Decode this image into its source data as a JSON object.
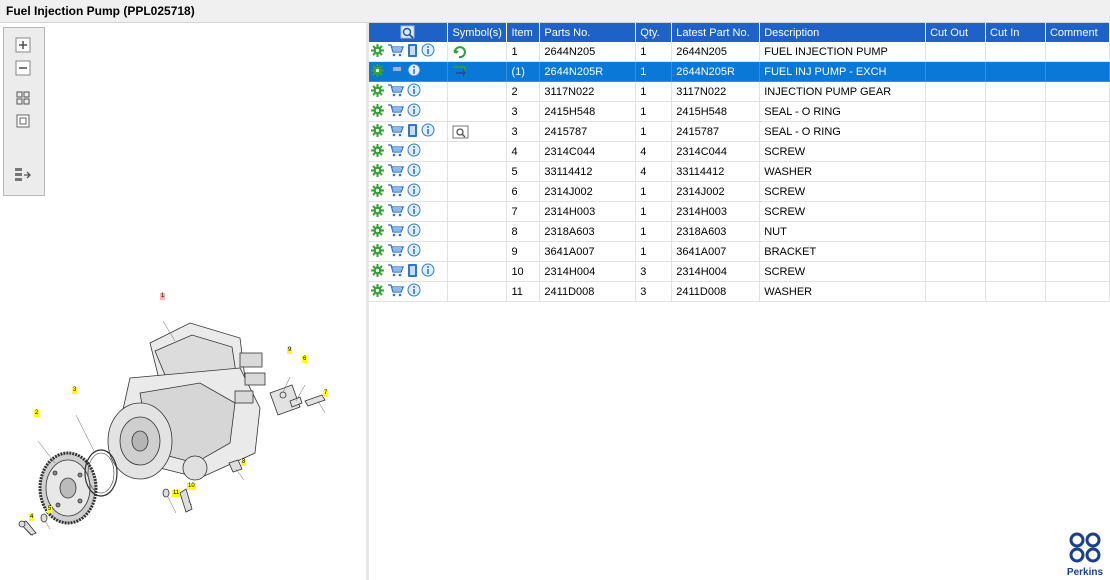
{
  "window": {
    "title": "Fuel Injection Pump (PPL025718)"
  },
  "table": {
    "headers": {
      "search": "",
      "symbols": "Symbol(s)",
      "item": "Item",
      "part_no": "Parts No.",
      "qty": "Qty.",
      "latest": "Latest Part No.",
      "description": "Description",
      "cut_out": "Cut Out",
      "cut_in": "Cut In",
      "comment": "Comment"
    },
    "rows": [
      {
        "item": "1",
        "part": "2644N205",
        "qty": "1",
        "latest": "2644N205",
        "desc": "FUEL INJECTION PUMP",
        "doc": true,
        "sym": "refresh"
      },
      {
        "item": "(1)",
        "part": "2644N205R",
        "qty": "1",
        "latest": "2644N205R",
        "desc": "FUEL INJ PUMP - EXCH",
        "doc": false,
        "sym": "exchange",
        "selected": true
      },
      {
        "item": "2",
        "part": "3117N022",
        "qty": "1",
        "latest": "3117N022",
        "desc": "INJECTION PUMP GEAR",
        "doc": false,
        "sym": ""
      },
      {
        "item": "3",
        "part": "2415H548",
        "qty": "1",
        "latest": "2415H548",
        "desc": "SEAL - O RING",
        "doc": false,
        "sym": ""
      },
      {
        "item": "3",
        "part": "2415787",
        "qty": "1",
        "latest": "2415787",
        "desc": "SEAL - O RING",
        "doc": true,
        "sym": "view"
      },
      {
        "item": "4",
        "part": "2314C044",
        "qty": "4",
        "latest": "2314C044",
        "desc": "SCREW",
        "doc": false,
        "sym": ""
      },
      {
        "item": "5",
        "part": "33114412",
        "qty": "4",
        "latest": "33114412",
        "desc": "WASHER",
        "doc": false,
        "sym": ""
      },
      {
        "item": "6",
        "part": "2314J002",
        "qty": "1",
        "latest": "2314J002",
        "desc": "SCREW",
        "doc": false,
        "sym": ""
      },
      {
        "item": "7",
        "part": "2314H003",
        "qty": "1",
        "latest": "2314H003",
        "desc": "SCREW",
        "doc": false,
        "sym": ""
      },
      {
        "item": "8",
        "part": "2318A603",
        "qty": "1",
        "latest": "2318A603",
        "desc": "NUT",
        "doc": false,
        "sym": ""
      },
      {
        "item": "9",
        "part": "3641A007",
        "qty": "1",
        "latest": "3641A007",
        "desc": "BRACKET",
        "doc": false,
        "sym": ""
      },
      {
        "item": "10",
        "part": "2314H004",
        "qty": "3",
        "latest": "2314H004",
        "desc": "SCREW",
        "doc": true,
        "sym": ""
      },
      {
        "item": "11",
        "part": "2411D008",
        "qty": "3",
        "latest": "2411D008",
        "desc": "WASHER",
        "doc": false,
        "sym": ""
      }
    ]
  },
  "diagram": {
    "callouts": [
      "1",
      "2",
      "3",
      "4",
      "5",
      "6",
      "7",
      "8",
      "9",
      "10",
      "11"
    ]
  },
  "logo": {
    "text": "Perkins"
  },
  "colors": {
    "header_bg": "#1f62c7",
    "selected_row": "#0a78d7",
    "gear_icon": "#3aa23a",
    "info_icon": "#2b7bd3"
  },
  "toolbar": {
    "icons": [
      "zoom-in-icon",
      "zoom-out-icon",
      "fit-all-icon",
      "fit-page-icon",
      "split-view-icon"
    ]
  }
}
